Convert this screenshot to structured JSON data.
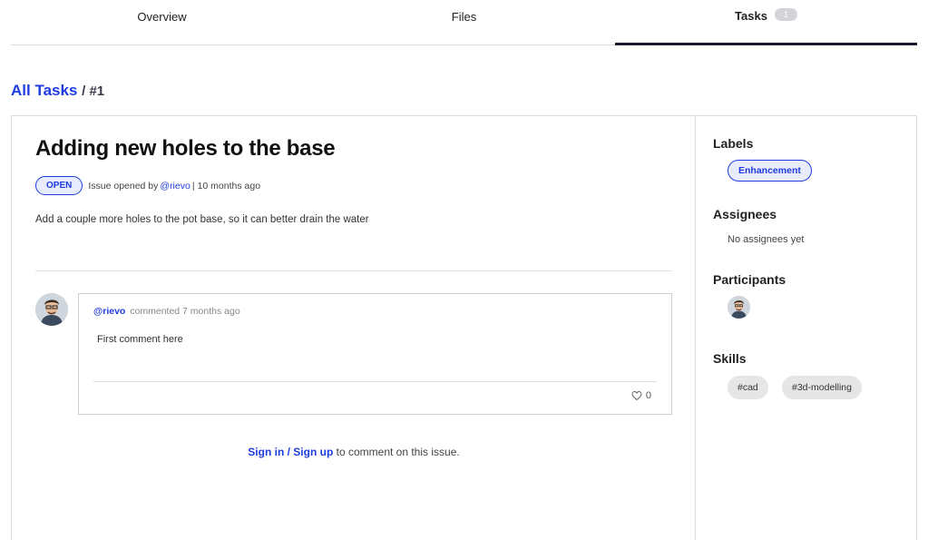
{
  "tabs": [
    {
      "label": "Overview"
    },
    {
      "label": "Files"
    },
    {
      "label": "Tasks",
      "count": "1"
    }
  ],
  "breadcrumb": {
    "link": "All Tasks",
    "current": "/ #1"
  },
  "issue": {
    "title": "Adding new holes to the base",
    "status": "OPEN",
    "opened_text": "Issue opened by",
    "author": "@rievo",
    "separator": "|",
    "time": "10 months ago",
    "description": "Add a couple more holes to the pot base, so it can better drain the water"
  },
  "comment": {
    "author": "@rievo",
    "action": "commented 7 months ago",
    "body": "First comment here",
    "likes": "0"
  },
  "signin": {
    "link": "Sign in / Sign up",
    "text": "to comment on this issue."
  },
  "sidebar": {
    "labels_heading": "Labels",
    "label": "Enhancement",
    "assignees_heading": "Assignees",
    "assignees_text": "No assignees yet",
    "participants_heading": "Participants",
    "skills_heading": "Skills",
    "skills": [
      "#cad",
      "#3d-modelling"
    ]
  },
  "colors": {
    "accent": "#1f3ce0",
    "accent_bg": "#e8ecfc",
    "border": "#dcdcdc"
  },
  "icons": {
    "like": "heart-icon",
    "avatar": "user-avatar"
  }
}
